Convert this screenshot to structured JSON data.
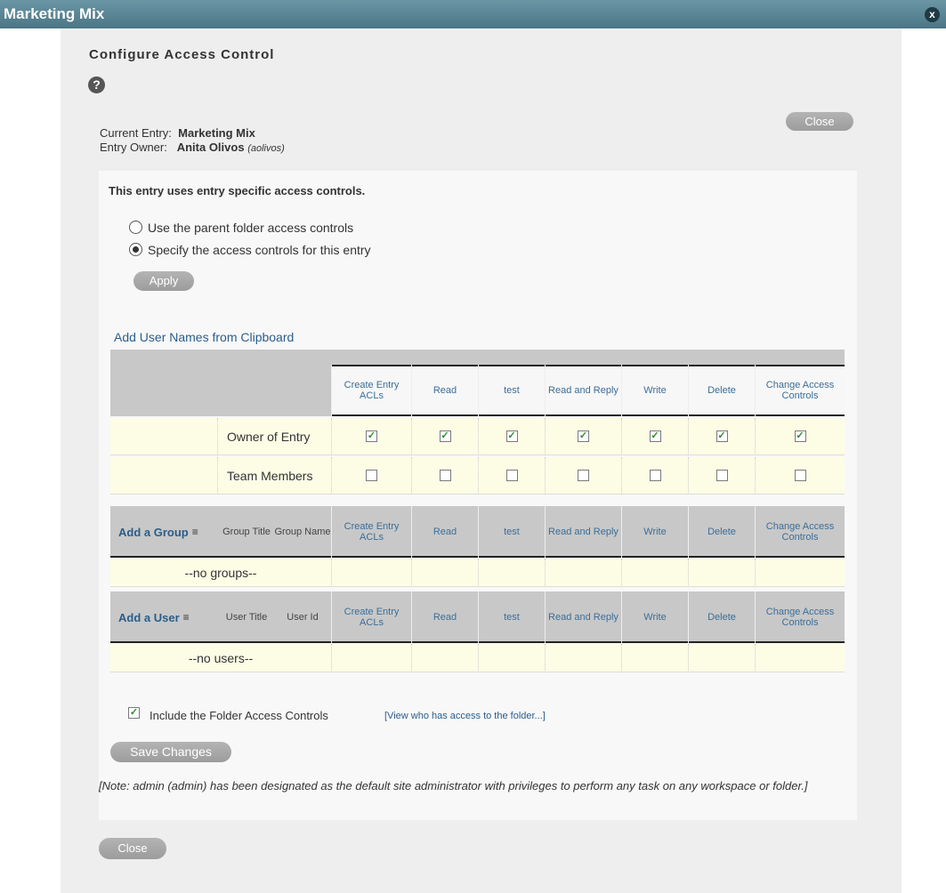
{
  "window": {
    "title": "Marketing Mix",
    "close_glyph": "x"
  },
  "page": {
    "heading": "Configure Access Control",
    "help_glyph": "?"
  },
  "entry_info": {
    "current_entry_label": "Current Entry:",
    "current_entry_value": "Marketing Mix",
    "owner_label": "Entry Owner:",
    "owner_name": "Anita Olivos",
    "owner_id": "(aolivos)"
  },
  "buttons": {
    "close_top": "Close",
    "apply": "Apply",
    "save_changes": "Save Changes",
    "close_bottom": "Close"
  },
  "access_mode": {
    "status_text": "This entry uses entry specific access controls.",
    "options": [
      {
        "label": "Use the parent folder access controls",
        "selected": false
      },
      {
        "label": "Specify the access controls for this entry",
        "selected": true
      }
    ]
  },
  "add_users_link": "Add User Names from Clipboard",
  "table": {
    "columns": [
      "Create Entry ACLs",
      "Read",
      "test",
      "Read and Reply",
      "Write",
      "Delete",
      "Change Access Controls"
    ],
    "rows": [
      {
        "label": "Owner of Entry",
        "checks": [
          true,
          true,
          true,
          true,
          true,
          true,
          true
        ]
      },
      {
        "label": "Team Members",
        "checks": [
          false,
          false,
          false,
          false,
          false,
          false,
          false
        ]
      }
    ],
    "group_section": {
      "add_label": "Add a Group",
      "col1": "Group Title",
      "col2": "Group Name",
      "empty": "--no groups--"
    },
    "user_section": {
      "add_label": "Add a User",
      "col1": "User Title",
      "col2": "User Id",
      "empty": "--no users--"
    }
  },
  "include_folder": {
    "checked": true,
    "label": "Include the Folder Access Controls",
    "link": "[View who has access to the folder...]"
  },
  "note": "[Note: admin (admin) has been designated as the default site administrator with privileges to perform any task on any workspace or folder.]",
  "colors": {
    "titlebar": "#5a8796",
    "header_gray": "#c8c8c8",
    "row_yellow": "#fdfde6",
    "link_blue": "#2a5d8a",
    "check_green": "#2e8b2e"
  }
}
